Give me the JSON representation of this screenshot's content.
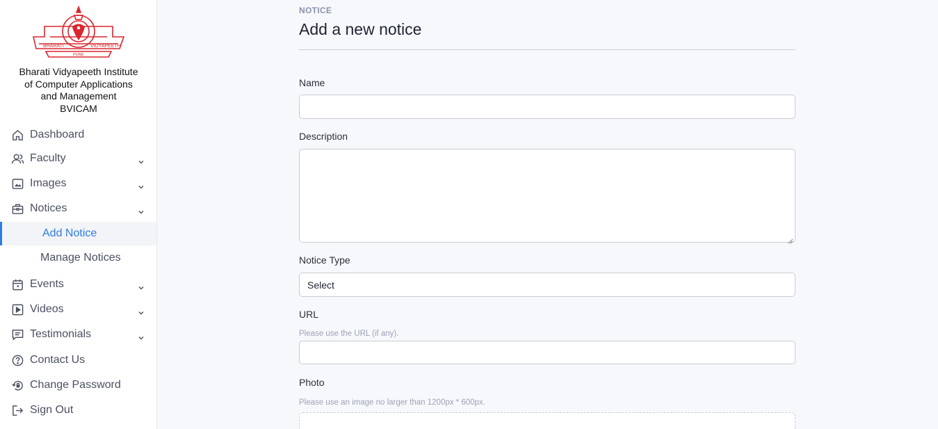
{
  "sidebar": {
    "logo_texts": [
      "BHARATI",
      "VIDYAPEETH",
      "PUNE"
    ],
    "org_name_lines": [
      "Bharati Vidyapeeth Institute",
      "of Computer Applications",
      "and Management",
      "BVICAM"
    ],
    "items": {
      "dashboard": "Dashboard",
      "faculty": "Faculty",
      "images": "Images",
      "notices": "Notices",
      "add_notice": "Add Notice",
      "manage_notices": "Manage Notices",
      "events": "Events",
      "videos": "Videos",
      "testimonials": "Testimonials",
      "contact_us": "Contact Us",
      "change_password": "Change Password",
      "sign_out": "Sign Out"
    },
    "icons": [
      "home-icon",
      "users-icon",
      "image-icon",
      "briefcase-icon",
      "calendar-icon",
      "play-icon",
      "message-icon",
      "help-circle-icon",
      "lock-reset-icon",
      "sign-out-icon"
    ],
    "active_color": "#2f7de1"
  },
  "form": {
    "eyebrow": "NOTICE",
    "title": "Add a new notice",
    "name_label": "Name",
    "name_value": "",
    "description_label": "Description",
    "description_value": "",
    "notice_type_label": "Notice Type",
    "notice_type_selected": "Select",
    "url_label": "URL",
    "url_help": "Please use the URL (if any).",
    "url_value": "",
    "photo_label": "Photo",
    "photo_help": "Please use an image no larger than 1200px * 600px."
  }
}
